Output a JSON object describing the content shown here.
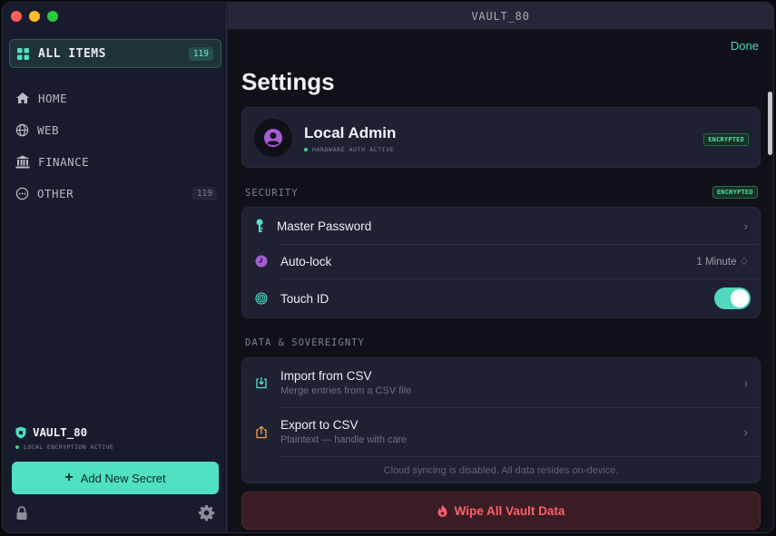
{
  "window": {
    "title": "VAULT_80"
  },
  "sidebar": {
    "all_items": {
      "label": "ALL ITEMS",
      "count": "119"
    },
    "items": [
      {
        "label": "HOME",
        "icon": "home-icon"
      },
      {
        "label": "WEB",
        "icon": "globe-icon"
      },
      {
        "label": "FINANCE",
        "icon": "bank-icon"
      },
      {
        "label": "OTHER",
        "icon": "more-icon",
        "count": "119"
      }
    ],
    "vault_name": "VAULT_80",
    "vault_status": "LOCAL ENCRYPTION ACTIVE",
    "add_button": "Add New Secret"
  },
  "main": {
    "done": "Done",
    "title": "Settings",
    "profile": {
      "name": "Local Admin",
      "status": "HARDWARE AUTH ACTIVE",
      "badge": "ENCRYPTED"
    },
    "security": {
      "heading": "SECURITY",
      "badge": "ENCRYPTED",
      "master_password": "Master Password",
      "auto_lock": "Auto-lock",
      "auto_lock_value": "1 Minute ♢",
      "touch_id": "Touch ID",
      "touch_id_enabled": true
    },
    "data": {
      "heading": "DATA & SOVEREIGNTY",
      "import_label": "Import from CSV",
      "import_sub": "Merge entries from a CSV file",
      "export_label": "Export to CSV",
      "export_sub": "Plaintext — handle with care",
      "footnote": "Cloud syncing is disabled. All data resides on-device."
    },
    "wipe": "Wipe All Vault Data"
  },
  "colors": {
    "accent": "#4fe1c2",
    "danger": "#ff5f6b",
    "encrypted": "#4fe3a4"
  }
}
